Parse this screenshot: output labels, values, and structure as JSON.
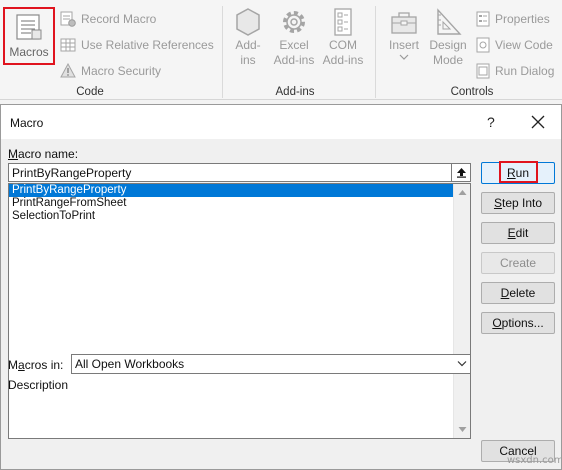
{
  "ribbon": {
    "groups": {
      "code": "Code",
      "addins": "Add-ins",
      "controls": "Controls"
    },
    "buttons": {
      "macros": "Macros",
      "record_macro": "Record Macro",
      "use_relative_references": "Use Relative References",
      "macro_security": "Macro Security",
      "addins_line1": "Add-",
      "addins_line2": "ins",
      "excel_addins_line1": "Excel",
      "excel_addins_line2": "Add-ins",
      "com_addins_line1": "COM",
      "com_addins_line2": "Add-ins",
      "insert": "Insert",
      "design_mode_line1": "Design",
      "design_mode_line2": "Mode",
      "properties": "Properties",
      "view_code": "View Code",
      "run_dialog": "Run Dialog"
    },
    "icons": {
      "macros": "macros-icon",
      "record_macro": "record-macro-icon",
      "relative_references": "grid-icon",
      "macro_security": "warning-icon",
      "addins": "hexagon-icon",
      "excel_addins": "gear-icon",
      "com_addins": "com-icon",
      "insert": "toolbox-icon",
      "design_mode": "ruler-triangle-icon",
      "properties": "properties-icon",
      "view_code": "view-code-icon",
      "run_dialog": "run-dialog-icon"
    }
  },
  "dialog": {
    "title": "Macro",
    "help": "?",
    "macro_name_label_underlined": "M",
    "macro_name_label_rest": "acro name:",
    "macro_name_value": "PrintByRangeProperty",
    "macros": [
      "PrintByRangeProperty",
      "PrintRangeFromSheet",
      "SelectionToPrint"
    ],
    "selected_index": 0,
    "buttons": {
      "run_underlined": "R",
      "run_rest": "un",
      "step_into_underlined": "S",
      "step_into_rest": "tep Into",
      "edit_underlined": "E",
      "edit_rest": "dit",
      "create": "Create",
      "delete_underlined": "D",
      "delete_rest": "elete",
      "options_underlined": "O",
      "options_rest": "ptions...",
      "cancel": "Cancel"
    },
    "macros_in_label_pre": "M",
    "macros_in_label_underlined": "a",
    "macros_in_label_rest": "cros in:",
    "macros_in_value": "All Open Workbooks",
    "description_label": "Description"
  },
  "watermark": "wsxdn.com",
  "colors": {
    "highlight": "#e0141e",
    "selection": "#0078d7"
  }
}
